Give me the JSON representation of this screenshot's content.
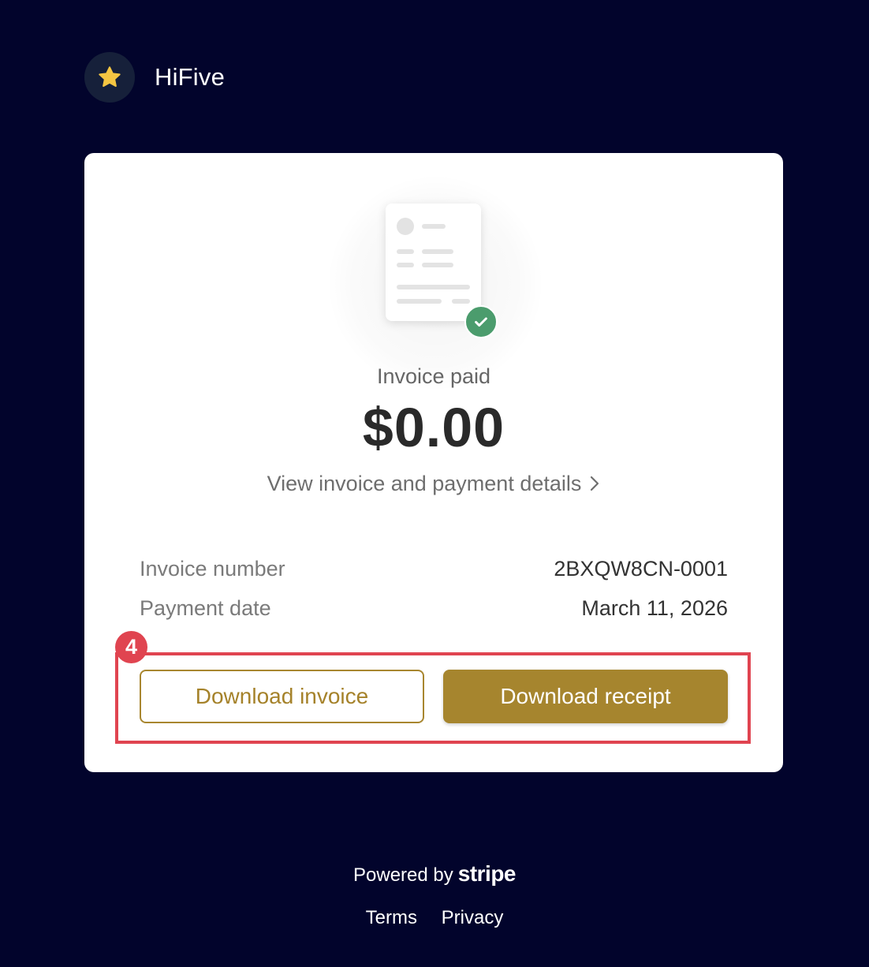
{
  "brand": {
    "name": "HiFive",
    "logo_icon": "star-icon"
  },
  "invoice": {
    "status": "Invoice paid",
    "amount": "$0.00",
    "details_link": "View invoice and payment details",
    "rows": [
      {
        "label": "Invoice number",
        "value": "2BXQW8CN-0001"
      },
      {
        "label": "Payment date",
        "value": "March 11, 2026"
      }
    ]
  },
  "actions": {
    "download_invoice": "Download invoice",
    "download_receipt": "Download receipt"
  },
  "annotation": {
    "badge": "4"
  },
  "footer": {
    "powered_by": "Powered by",
    "stripe": "stripe",
    "terms": "Terms",
    "privacy": "Privacy"
  },
  "colors": {
    "background": "#02042c",
    "accent": "#a6852e",
    "success": "#4b9c6d",
    "highlight": "#e04450"
  }
}
